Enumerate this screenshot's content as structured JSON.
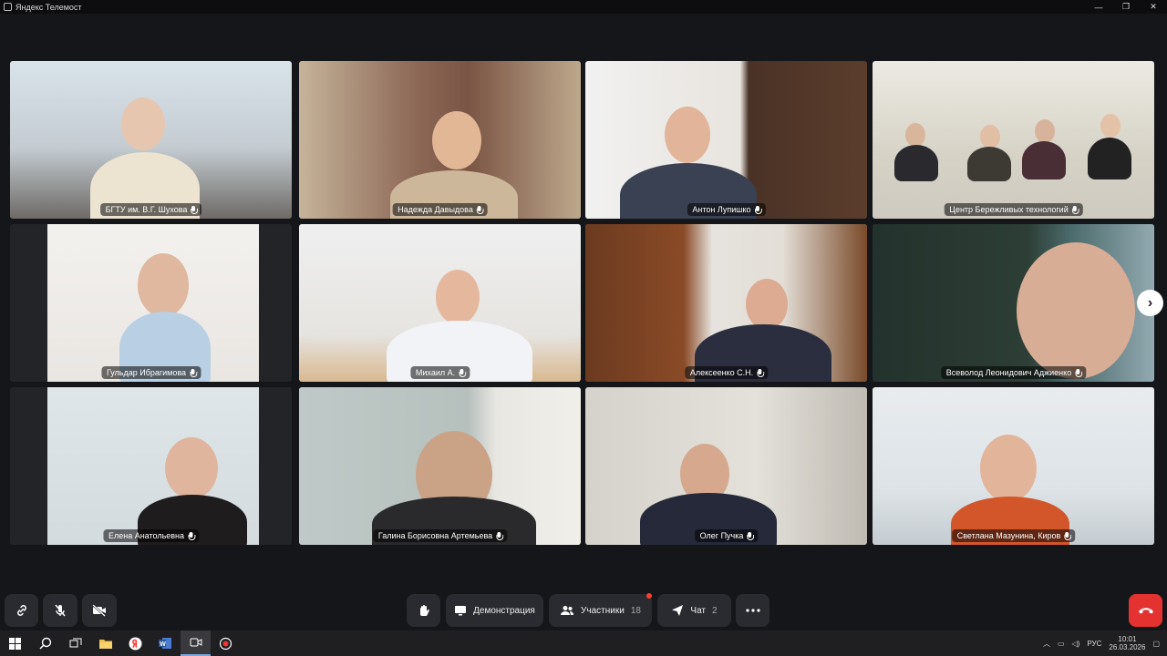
{
  "window": {
    "title": "Яндекс Телемост"
  },
  "participants": [
    {
      "name": "БГТУ им. В.Г. Шухова"
    },
    {
      "name": "Надежда Давыдова"
    },
    {
      "name": "Антон Лупишко"
    },
    {
      "name": "Центр Бережливых технологий"
    },
    {
      "name": "Гульдар Ибрагимова"
    },
    {
      "name": "Михаил А."
    },
    {
      "name": "Алексеенко С.Н."
    },
    {
      "name": "Всеволод Леонидович Аджиенко"
    },
    {
      "name": "Елена Анатольевна"
    },
    {
      "name": "Галина Борисовна Артемьева"
    },
    {
      "name": "Олег Пучка"
    },
    {
      "name": "Светлана Мазунина, Киров"
    }
  ],
  "toolbar": {
    "demo_label": "Демонстрация",
    "participants_label": "Участники",
    "participants_count": "18",
    "chat_label": "Чат",
    "chat_count": "2"
  },
  "taskbar": {
    "lang": "РУС",
    "time": "10:01",
    "date": "26.03.2026"
  },
  "colors": {
    "speaking": "#38d86b",
    "hangup": "#e3322f"
  }
}
